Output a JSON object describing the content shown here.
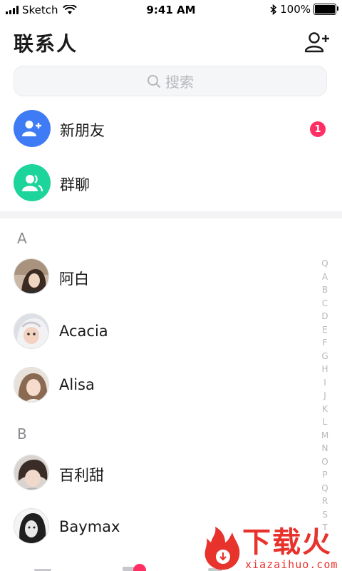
{
  "status_bar": {
    "carrier": "Sketch",
    "time": "9:41 AM",
    "battery": "100%"
  },
  "header": {
    "title": "联系人",
    "add_icon": "add-user-icon"
  },
  "search": {
    "placeholder": "搜索",
    "icon": "search-icon"
  },
  "fixed_rows": [
    {
      "label": "新朋友",
      "icon": "add-user-icon",
      "color": "#3f7bf5",
      "badge": "1"
    },
    {
      "label": "群聊",
      "icon": "group-icon",
      "color": "#1dd49a"
    }
  ],
  "sections": [
    {
      "letter": "A",
      "contacts": [
        "阿白",
        "Acacia",
        "Alisa"
      ]
    },
    {
      "letter": "B",
      "contacts": [
        "百利甜",
        "Baymax"
      ]
    }
  ],
  "index_letters": [
    "Q",
    "A",
    "B",
    "C",
    "D",
    "E",
    "F",
    "G",
    "H",
    "I",
    "J",
    "K",
    "L",
    "M",
    "N",
    "O",
    "P",
    "Q",
    "R",
    "S",
    "T"
  ],
  "colors": {
    "badge": "#ff2e63",
    "new_friend": "#3f7bf5",
    "group_chat": "#1dd49a",
    "watermark": "#e8322c"
  },
  "watermark": {
    "brand": "下载火",
    "url": "xiazaihuo.com"
  }
}
